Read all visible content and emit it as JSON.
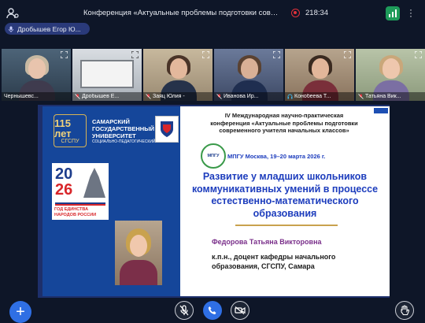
{
  "topbar": {
    "title": "Конференция «Актуальные проблемы подготовки современно...",
    "timer": "218:34",
    "icons": {
      "people": "people-settings-icon",
      "record": "record-icon",
      "signal": "signal-icon",
      "more": "more-vertical-icon"
    }
  },
  "user_chip": {
    "name": "Дробышев Егор Ю...",
    "icon": "microphone-icon"
  },
  "participants": [
    {
      "name": "Чернышевс...",
      "muted": true
    },
    {
      "name": "Дробышев Е...",
      "muted": true
    },
    {
      "name": "Заяц Юлия -",
      "muted": true
    },
    {
      "name": "Иванова Ир...",
      "muted": true
    },
    {
      "name": "Конобеева Т...",
      "muted": false
    },
    {
      "name": "Татьяна Вик...",
      "muted": true
    }
  ],
  "slide": {
    "logo_number": "115 лет",
    "logo_abbr": "СГСПУ",
    "university": "Самарский государственный университет",
    "university_sub": "социально-педагогический",
    "poster_year_a": "20",
    "poster_year_b": "26",
    "poster_text": "Год единства народов России",
    "mpgu_logo_text": "МПГУ",
    "conference_title": "IV Международная научно-практическая конференция «Актуальные проблемы подготовки современного учителя начальных классов»",
    "conference_date": "МПГУ Москва, 19–20 марта 2026 г.",
    "talk_title": "Развитие у младших школьников коммуникативных умений в процессе естественно-математического образования",
    "speaker_name": "Федорова Татьяна Викторовна",
    "speaker_role": "к.п.н., доцент кафедры начального образования, СГСПУ, Самара"
  },
  "controls": {
    "add": "+",
    "icons": {
      "add": "plus-icon",
      "mic": "microphone-icon",
      "call": "phone-icon",
      "camera": "camera-icon",
      "hand": "raise-hand-icon"
    }
  },
  "colors": {
    "background": "#0e1628",
    "accent_blue": "#2f6fe4",
    "slide_blue": "#1d3dbd",
    "record_red": "#e0313a",
    "signal_green": "#1e9b5a"
  }
}
